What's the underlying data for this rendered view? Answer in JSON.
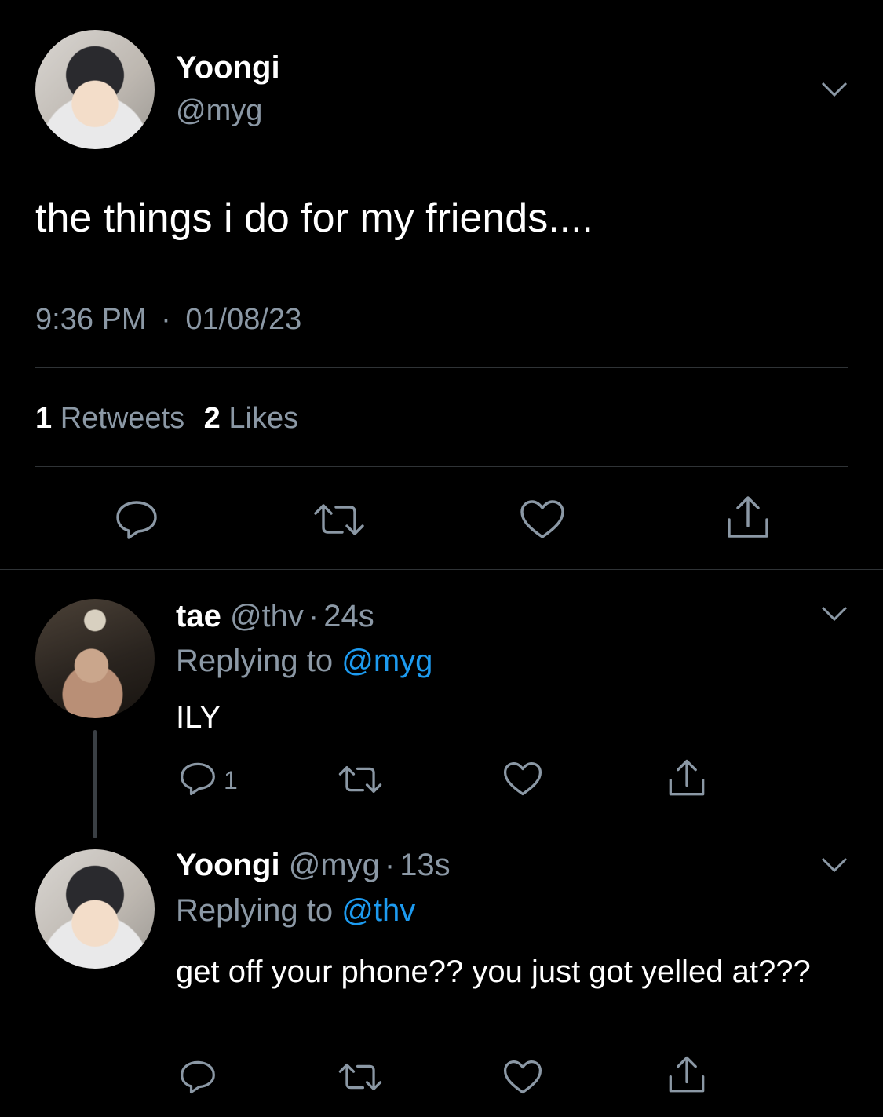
{
  "main_tweet": {
    "display_name": "Yoongi",
    "handle": "@myg",
    "text": "the things i do for my friends....",
    "time": "9:36 PM",
    "date_separator": "·",
    "date": "01/08/23",
    "retweets_count": "1",
    "retweets_label": "Retweets",
    "likes_count": "2",
    "likes_label": "Likes"
  },
  "replies": [
    {
      "display_name": "tae",
      "handle": "@thv",
      "separator": "·",
      "time": "24s",
      "replying_prefix": "Replying to",
      "replying_to": "@myg",
      "text": "ILY",
      "reply_count": "1"
    },
    {
      "display_name": "Yoongi",
      "handle": "@myg",
      "separator": "·",
      "time": "13s",
      "replying_prefix": "Replying to",
      "replying_to": "@thv",
      "text": "get off your phone?? you just got yelled at???"
    }
  ],
  "icons": [
    "reply-icon",
    "retweet-icon",
    "like-icon",
    "share-icon",
    "chevron-down-icon"
  ],
  "colors": {
    "background": "#000000",
    "text": "#ffffff",
    "muted": "#8b98a5",
    "link": "#1d9bf0",
    "divider": "#2f3336"
  }
}
